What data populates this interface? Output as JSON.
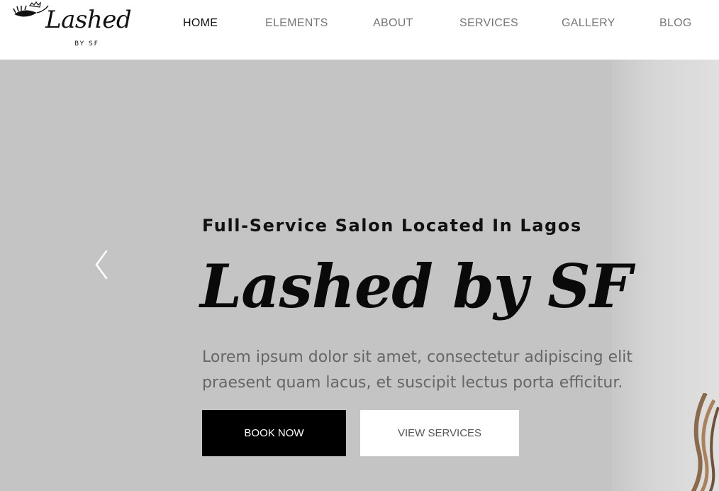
{
  "logo": {
    "script": "Lashed",
    "sub": "BY SF"
  },
  "nav": {
    "items": [
      {
        "label": "HOME"
      },
      {
        "label": "ELEMENTS"
      },
      {
        "label": "ABOUT"
      },
      {
        "label": "SERVICES"
      },
      {
        "label": "GALLERY"
      },
      {
        "label": "BLOG"
      }
    ],
    "active": "HOME"
  },
  "hero": {
    "subtitle": "Full-Service Salon Located In Lagos",
    "title": "Lashed by SF",
    "description_lines": [
      "Lorem ipsum dolor sit amet, consectetur adipiscing elit",
      "praesent quam lacus, et suscipit lectus porta efficitur."
    ],
    "prev_icon": "chevron-left-icon",
    "buttons": {
      "book": "BOOK NOW",
      "services": "VIEW SERVICES"
    }
  },
  "colors": {
    "hero_background": "#c4c4c4",
    "primary_button": "#000000",
    "secondary_button": "#ffffff",
    "nav_active": "#111111",
    "nav_inactive": "#777777"
  }
}
